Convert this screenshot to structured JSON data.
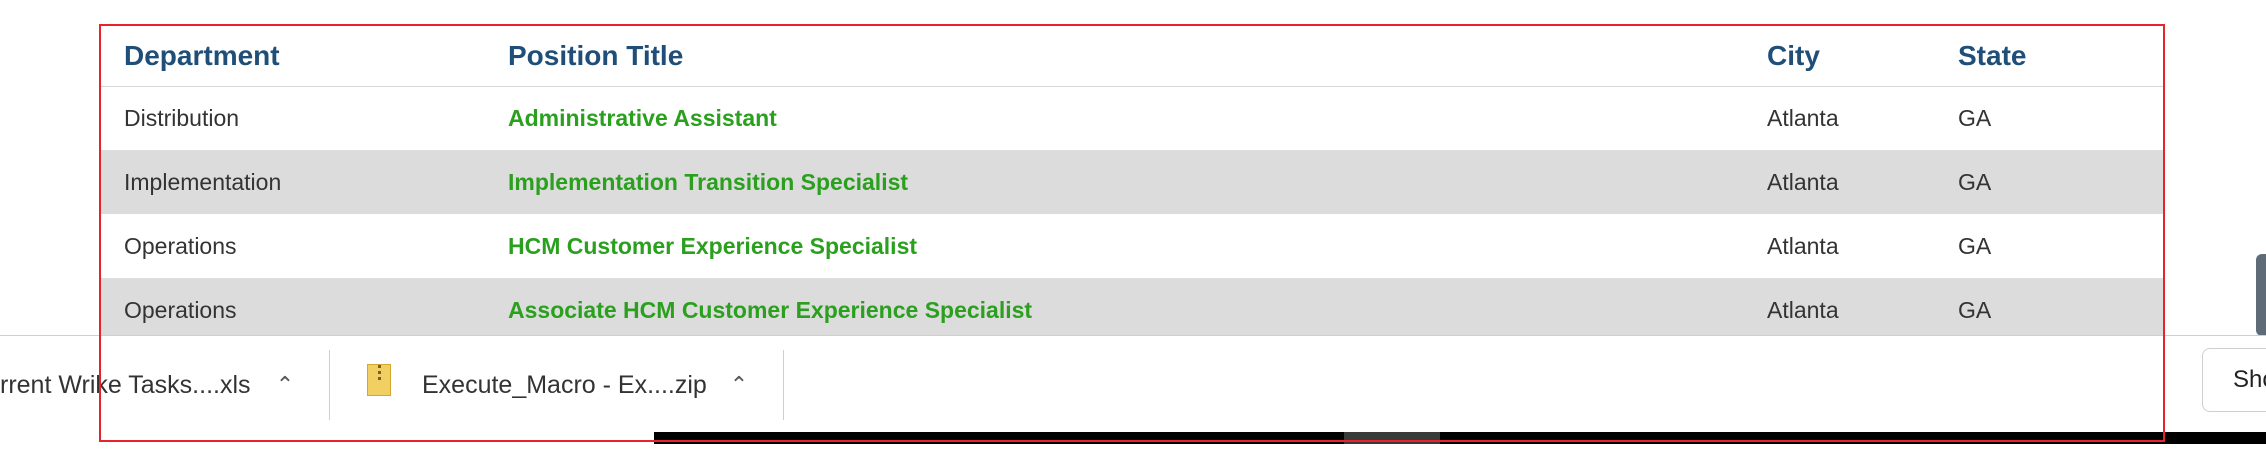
{
  "table": {
    "headers": {
      "department": "Department",
      "position_title": "Position Title",
      "city": "City",
      "state": "State"
    },
    "rows": [
      {
        "department": "Distribution",
        "position_title": "Administrative Assistant",
        "city": "Atlanta",
        "state": "GA"
      },
      {
        "department": "Implementation",
        "position_title": "Implementation Transition Specialist",
        "city": "Atlanta",
        "state": "GA"
      },
      {
        "department": "Operations",
        "position_title": "HCM Customer Experience Specialist",
        "city": "Atlanta",
        "state": "GA"
      },
      {
        "department": "Operations",
        "position_title": "Associate HCM Customer Experience Specialist",
        "city": "Atlanta",
        "state": "GA"
      }
    ]
  },
  "download_bar": {
    "items": [
      {
        "name": "rrent Wrike Tasks....xls",
        "icon": "chevron-up-icon"
      },
      {
        "name": "Execute_Macro - Ex....zip",
        "icon": "zip-file-icon"
      }
    ],
    "show_all_label": "Sho"
  },
  "colors": {
    "header_text": "#1f4e79",
    "link_text": "#2aa01e",
    "row_shade": "#dcdcdc",
    "frame_border": "#e8232a"
  }
}
